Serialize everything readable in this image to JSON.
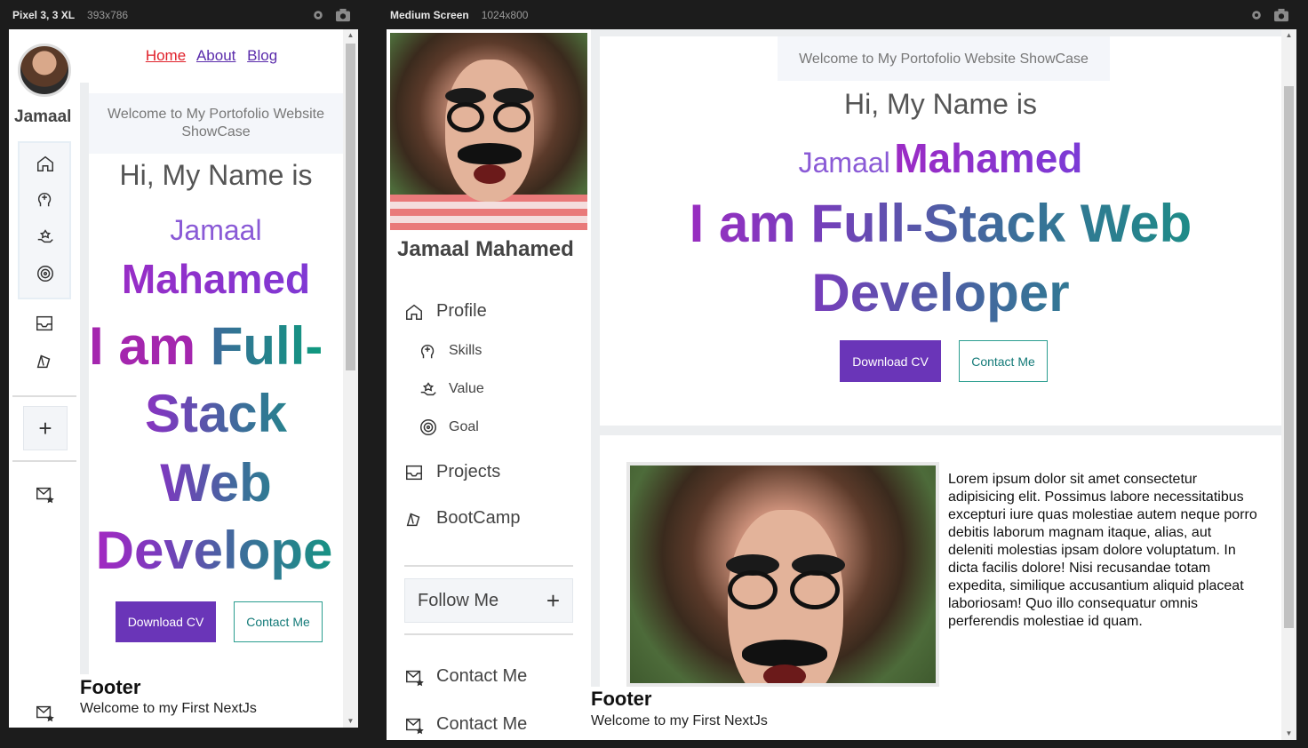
{
  "devtools": {
    "left": {
      "device": "Pixel 3, 3 XL",
      "dims": "393x786"
    },
    "right": {
      "device": "Medium Screen",
      "dims": "1024x800"
    }
  },
  "site": {
    "nav": [
      "Home",
      "About",
      "Blog"
    ],
    "short_name": "Jamaal",
    "full_name": "Jamaal Mahamed",
    "welcome": "Welcome to My Portofolio Website ShowCase",
    "hi": "Hi, My Name is",
    "first": "Jamaal",
    "last": "Mahamed",
    "headline_a": "I am Full-Stack Web",
    "headline_b": "Developer",
    "mobile_headline": {
      "l1_plain": "I am ",
      "l1_grad": "Full-",
      "l2": "Stack",
      "l3": "Web",
      "l4": "Develope"
    },
    "download": "Download CV",
    "contact": "Contact Me",
    "menu": {
      "profile": "Profile",
      "skills": "Skills",
      "value": "Value",
      "goal": "Goal",
      "projects": "Projects",
      "bootcamp": "BootCamp",
      "follow": "Follow Me",
      "contact1": "Contact Me",
      "contact2": "Contact Me"
    },
    "lorem": "Lorem ipsum dolor sit amet consectetur adipisicing elit. Possimus labore necessitatibus excepturi iure quas molestiae autem neque porro debitis laborum magnam itaque, alias, aut deleniti molestias ipsam dolore voluptatum. In dicta facilis dolore! Nisi recusandae totam expedita, similique accusantium aliquid placeat laboriosam! Quo illo consequatur omnis perferendis molestiae id quam.",
    "footer_title": "Footer",
    "footer_text": "Welcome to my First NextJs"
  },
  "colors": {
    "accent": "#6a35b8",
    "teal": "#2a9d8f",
    "link_active": "#e0202a",
    "link": "#5a2bab"
  }
}
